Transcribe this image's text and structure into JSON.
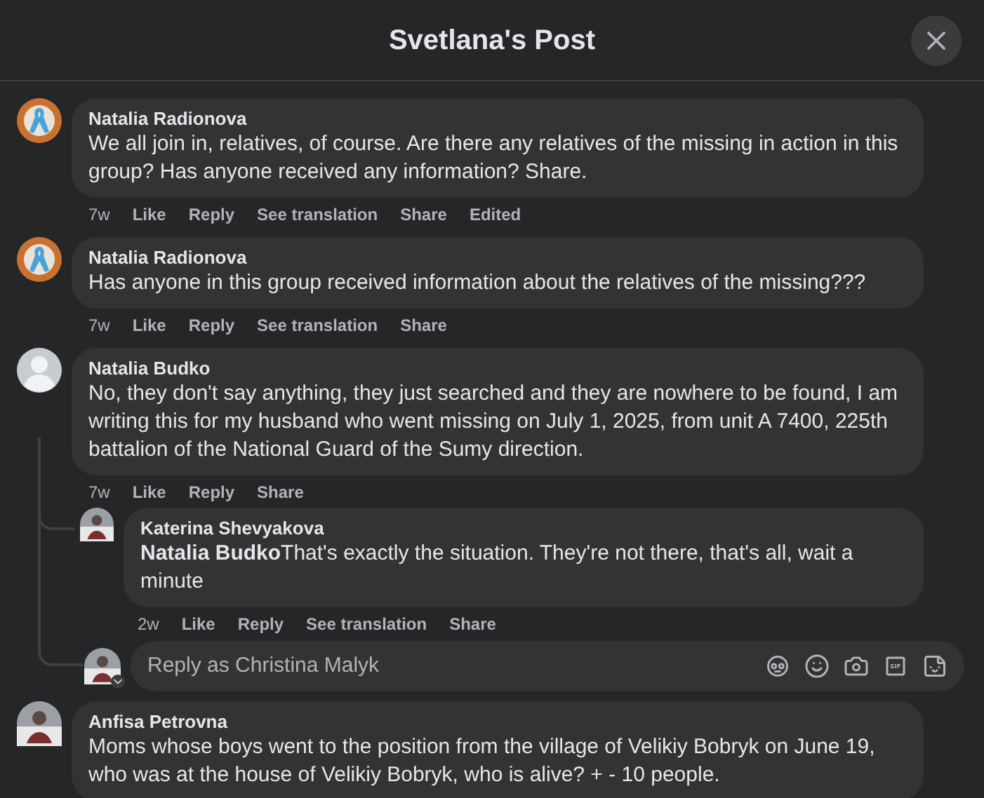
{
  "header": {
    "title": "Svetlana's Post"
  },
  "comments": [
    {
      "author": "Natalia Radionova",
      "avatar": {
        "kind": "ribbon"
      },
      "text": "We all join in, relatives, of course. Are there any relatives of the missing in action in this group? Has anyone received any information? Share.",
      "actions": [
        "7w",
        "Like",
        "Reply",
        "See translation",
        "Share",
        "Edited"
      ]
    },
    {
      "author": "Natalia Radionova",
      "avatar": {
        "kind": "ribbon"
      },
      "text": "Has anyone in this group received information about the relatives of the missing???",
      "actions": [
        "7w",
        "Like",
        "Reply",
        "See translation",
        "Share"
      ]
    },
    {
      "author": "Natalia Budko",
      "avatar": {
        "kind": "default"
      },
      "text": "No, they don't say anything, they just searched and they are nowhere to be found, I am writing this for my husband who went missing on July 1, 2025, from unit A 7400, 225th battalion of the National Guard of the Sumy direction.",
      "actions": [
        "7w",
        "Like",
        "Reply",
        "Share"
      ],
      "replies": [
        {
          "author": "Katerina Shevyakova",
          "avatar": {
            "kind": "photo"
          },
          "text": "**Natalia Budko**That's exactly the situation. They're not there, that's all, wait a minute",
          "actions": [
            "2w",
            "Like",
            "Reply",
            "See translation",
            "Share"
          ]
        }
      ],
      "reply_field": {
        "placeholder": "Reply as Christina Malyk"
      }
    },
    {
      "author": "Anfisa Petrovna",
      "avatar": {
        "kind": "photo"
      },
      "text": "Moms whose boys went to the position from the village of Velikiy Bobryk on June 19, who was at the house of Velikiy Bobryk, who is alive? + - 10 people."
    }
  ]
}
